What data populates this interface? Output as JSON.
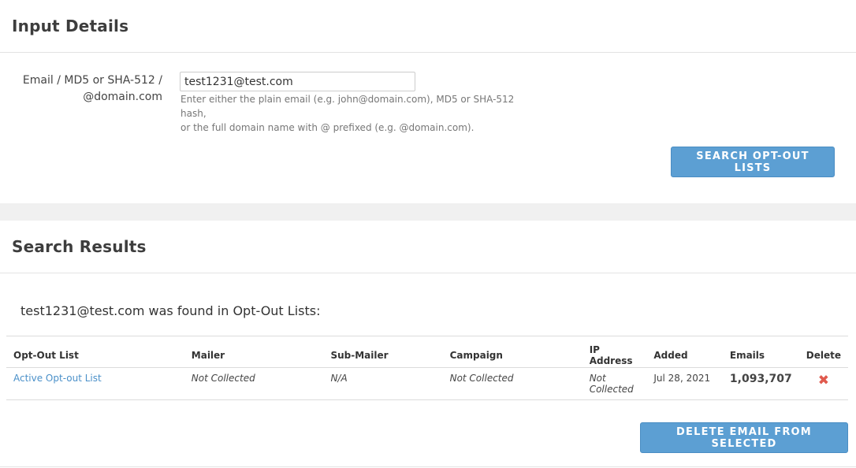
{
  "input_panel": {
    "title": "Input Details",
    "field_label_line1": "Email / MD5 or SHA-512 /",
    "field_label_line2": "@domain.com",
    "email_value": "test1231@test.com",
    "help_line1": "Enter either the plain email (e.g. john@domain.com), MD5 or SHA-512 hash,",
    "help_line2": "or the full domain name with @ prefixed (e.g. @domain.com).",
    "search_button": "SEARCH OPT-OUT LISTS"
  },
  "results_panel": {
    "title": "Search Results",
    "found_message": "test1231@test.com was found in Opt-Out Lists:",
    "columns": {
      "list": "Opt-Out List",
      "mailer": "Mailer",
      "sub_mailer": "Sub-Mailer",
      "campaign": "Campaign",
      "ip": "IP Address",
      "added": "Added",
      "emails": "Emails",
      "delete": "Delete"
    },
    "rows": [
      {
        "list": "Active Opt-out List",
        "mailer": "Not Collected",
        "sub_mailer": "N/A",
        "campaign": "Not Collected",
        "ip_line1": "Not",
        "ip_line2": "Collected",
        "added": "Jul 28, 2021",
        "emails": "1,093,707",
        "delete_icon": "close-x-icon",
        "delete_glyph": "✖"
      }
    ],
    "delete_button": "DELETE EMAIL FROM SELECTED"
  },
  "colors": {
    "button": "#5c9fd3",
    "link": "#4a90c9",
    "delete_icon": "#e05a4e"
  }
}
